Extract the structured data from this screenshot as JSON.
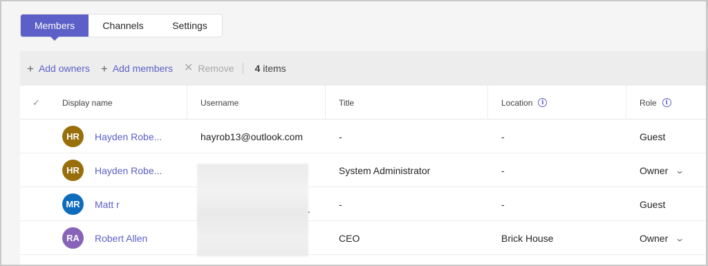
{
  "tabs": [
    {
      "label": "Members",
      "active": true
    },
    {
      "label": "Channels",
      "active": false
    },
    {
      "label": "Settings",
      "active": false
    }
  ],
  "toolbar": {
    "add_owners": "Add owners",
    "add_members": "Add members",
    "remove": "Remove",
    "count_number": "4",
    "count_suffix": " items"
  },
  "table": {
    "headers": {
      "display_name": "Display name",
      "username": "Username",
      "title": "Title",
      "location": "Location",
      "role": "Role"
    },
    "rows": [
      {
        "initials": "HR",
        "avatar_color": "#986f0b",
        "name": "Hayden Robe...",
        "username": "hayrob13@outlook.com",
        "title": "-",
        "location": "-",
        "role": "Guest",
        "role_dropdown": false
      },
      {
        "initials": "HR",
        "avatar_color": "#986f0b",
        "name": "Hayden Robe...",
        "username": ".",
        "title": "System Administrator",
        "location": "-",
        "role": "Owner",
        "role_dropdown": true
      },
      {
        "initials": "MR",
        "avatar_color": "#0f6cbd",
        "name": "Matt r",
        "username": "",
        "title": "-",
        "location": "-",
        "role": "Guest",
        "role_dropdown": false
      },
      {
        "initials": "RA",
        "avatar_color": "#8764b8",
        "name": "Robert Allen",
        "username": "",
        "title": "CEO",
        "location": "Brick House",
        "role": "Owner",
        "role_dropdown": true
      }
    ]
  },
  "colors": {
    "accent": "#5b5fc7"
  }
}
